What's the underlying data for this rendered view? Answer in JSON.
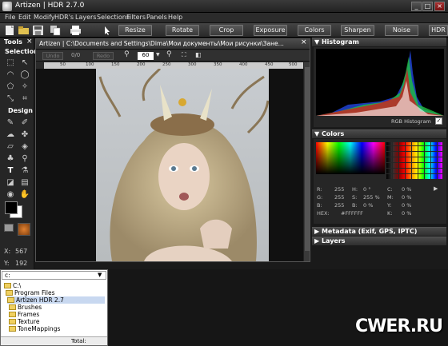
{
  "window": {
    "title": "Artizen | HDR 2.7.0",
    "controls": [
      "_",
      "□",
      "×"
    ]
  },
  "menubar": [
    "File",
    "Edit",
    "Modify",
    "HDR's",
    "Layers",
    "Selections",
    "Filters",
    "Panels",
    "Help"
  ],
  "toolbar": {
    "buttons": [
      "Resize",
      "Rotate",
      "Crop",
      "Exposure",
      "Colors",
      "Sharpen",
      "Noise",
      "HDR"
    ]
  },
  "tools_panel": {
    "title": "Tools",
    "selection_label": "Selection",
    "design_label": "Design",
    "x_label": "X:",
    "x_value": "567",
    "y_label": "Y:",
    "y_value": "192"
  },
  "document": {
    "title": "Artizen | C:\\Documents and Settings\\Dima\\Мои документы\\Мои рисунки\\Зане...",
    "undo_label": "Undo",
    "undo_count": "0/0",
    "redo_label": "Redo",
    "zoom_value": "60",
    "ruler_ticks": [
      "50",
      "100",
      "150",
      "200",
      "250",
      "300",
      "350",
      "400",
      "450",
      "500"
    ]
  },
  "histogram": {
    "title": "Histogram",
    "mode_label": "RGB Histogram"
  },
  "colors_panel": {
    "title": "Colors",
    "rows": [
      {
        "label": "R:",
        "value": "255",
        "label2": "H:",
        "value2": "0 °",
        "label3": "C:",
        "value3": "0 %"
      },
      {
        "label": "G:",
        "value": "255",
        "label2": "S:",
        "value2": "255 %",
        "label3": "M:",
        "value3": "0 %"
      },
      {
        "label": "B:",
        "value": "255",
        "label2": "B:",
        "value2": "0 %",
        "label3": "Y:",
        "value3": "0 %"
      },
      {
        "label": "HEX:",
        "value": "#FFFFFF",
        "label2": "",
        "value2": "",
        "label3": "K:",
        "value3": "0 %"
      }
    ]
  },
  "metadata_panel": {
    "title": "Metadata (Exif, GPS, IPTC)"
  },
  "layers_panel": {
    "title": "Layers"
  },
  "browser": {
    "drive": "c:",
    "tree": [
      "C:\\",
      "Program Files",
      "Artizen HDR 2.7",
      "Brushes",
      "Frames",
      "Texture",
      "ToneMappings"
    ],
    "total_label": "Total:"
  },
  "watermark": "CWER.RU"
}
